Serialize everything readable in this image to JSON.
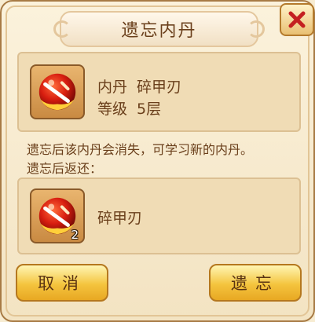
{
  "title": "遗忘内丹",
  "close_icon": "close-icon",
  "core": {
    "name_label": "内丹",
    "name_value": "碎甲刃",
    "level_label": "等级",
    "level_value": "5层",
    "icon": "core-orb-icon"
  },
  "description": {
    "line1": "遗忘后该内丹会消失，可学习新的内丹。",
    "line2": "遗忘后返还："
  },
  "reward": {
    "name": "碎甲刃",
    "count": "2",
    "icon": "core-orb-icon"
  },
  "buttons": {
    "cancel_label": "取消",
    "confirm_label": "遗忘"
  },
  "colors": {
    "accent": "#f4c43e",
    "close_red": "#c42020",
    "text_brown": "#6a3f1b"
  }
}
